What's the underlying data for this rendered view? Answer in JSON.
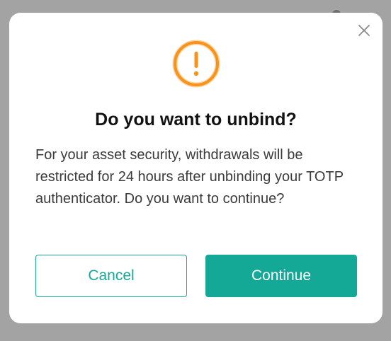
{
  "dialog": {
    "title": "Do you want to unbind?",
    "message": "For your asset security, withdrawals will be restricted for 24 hours after unbinding your TOTP authenticator. Do you want to continue?",
    "icon": "exclamation-circle-icon",
    "close_icon": "close-icon",
    "cancel_label": "Cancel",
    "continue_label": "Continue"
  },
  "colors": {
    "accent": "#14a896",
    "warning": "#f7931a",
    "backdrop": "#a3a3a3"
  }
}
